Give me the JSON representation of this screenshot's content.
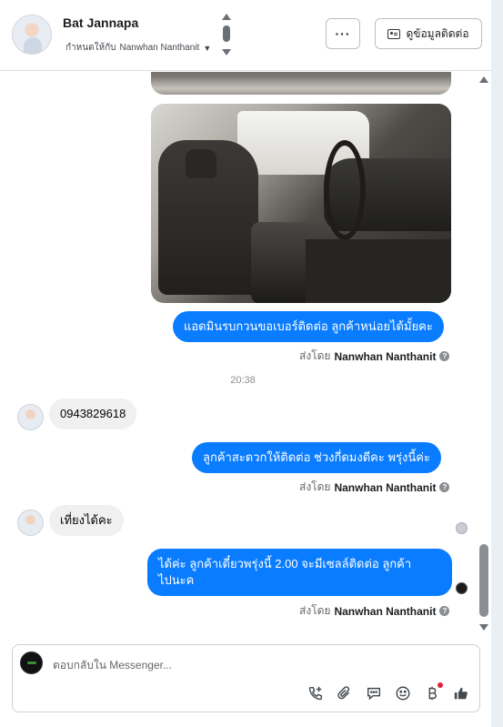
{
  "header": {
    "contact_name": "Bat Jannapa",
    "assigned_prefix": "กำหนดให้กับ",
    "assigned_to": "Nanwhan Nanthanit",
    "more_label": "···",
    "contact_info_label": "ดูข้อมูลติดต่อ"
  },
  "messages": [
    {
      "type": "outgoing",
      "text": "แอดมินรบกวนขอเบอร์ติดต่อ ลูกค้าหน่อยได้มั้ยคะ",
      "sent_by_prefix": "ส่งโดย",
      "sent_by": "Nanwhan Nanthanit"
    },
    {
      "type": "timestamp",
      "text": "20:38"
    },
    {
      "type": "incoming",
      "text": "0943829618"
    },
    {
      "type": "outgoing",
      "text": "ลูกค้าสะดวกให้ติดต่อ ช่วงกี่ดมงดีคะ  พรุ่งนี้ค่ะ",
      "sent_by_prefix": "ส่งโดย",
      "sent_by": "Nanwhan Nanthanit"
    },
    {
      "type": "incoming",
      "text": "เที่ยงได้คะ"
    },
    {
      "type": "outgoing",
      "line1": "ได้ค่ะ  ลูกค้าเดี๋ยวพรุ่งนี้  2.00 จะมีเซลล์ติดต่อ ลูกค้า",
      "line2": "ไปนะค",
      "sent_by_prefix": "ส่งโดย",
      "sent_by": "Nanwhan Nanthanit"
    }
  ],
  "composer": {
    "placeholder": "ตอบกลับใน Messenger..."
  },
  "icons": [
    "call-add-icon",
    "attachment-icon",
    "saved-reply-icon",
    "emoji-icon",
    "payment-icon",
    "like-icon"
  ],
  "colors": {
    "outgoing_bubble": "#0a7cff",
    "incoming_bubble": "#f0f0f0"
  }
}
